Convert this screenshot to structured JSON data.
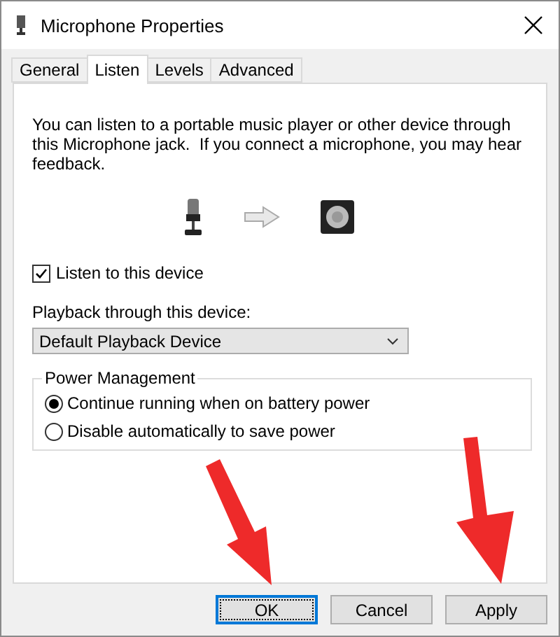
{
  "window": {
    "title": "Microphone Properties"
  },
  "tabs": [
    {
      "label": "General",
      "selected": false
    },
    {
      "label": "Listen",
      "selected": true
    },
    {
      "label": "Levels",
      "selected": false
    },
    {
      "label": "Advanced",
      "selected": false
    }
  ],
  "description": "You can listen to a portable music player or other device through this Microphone jack.  If you connect a microphone, you may hear feedback.",
  "listen_checkbox": {
    "label": "Listen to this device",
    "checked": true
  },
  "playback": {
    "label": "Playback through this device:",
    "value": "Default Playback Device"
  },
  "power_management": {
    "title": "Power Management",
    "options": [
      {
        "label": "Continue running when on battery power",
        "selected": true
      },
      {
        "label": "Disable automatically to save power",
        "selected": false
      }
    ]
  },
  "buttons": [
    {
      "label": "OK",
      "kind": "default"
    },
    {
      "label": "Cancel",
      "kind": "normal"
    },
    {
      "label": "Apply",
      "kind": "normal"
    }
  ]
}
